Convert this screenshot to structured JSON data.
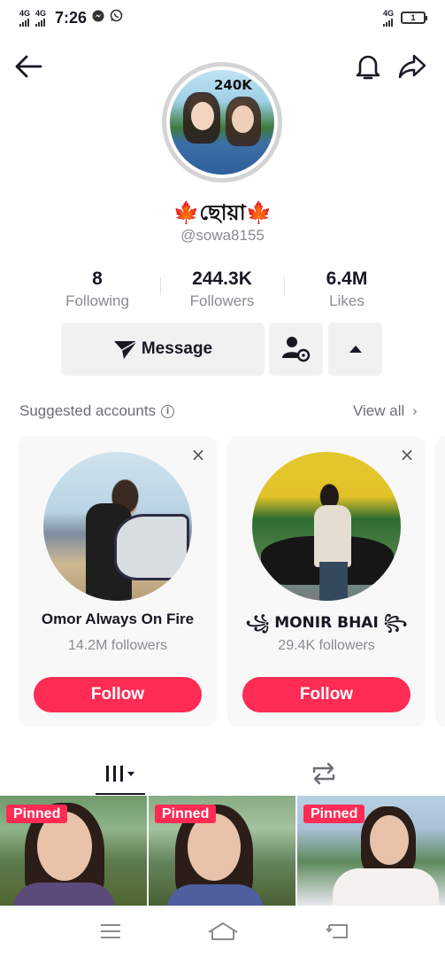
{
  "status_bar": {
    "network_1": "4G",
    "network_2": "4G",
    "time": "7:26",
    "right_network": "4G",
    "battery": "1"
  },
  "profile": {
    "avatar_badge": "240K",
    "display_name": "🍁ছোয়া🍁",
    "username": "@sowa8155",
    "stats": {
      "following_count": "8",
      "following_label": "Following",
      "followers_count": "244.3K",
      "followers_label": "Followers",
      "likes_count": "6.4M",
      "likes_label": "Likes"
    },
    "message_label": "Message"
  },
  "suggested": {
    "title": "Suggested accounts",
    "view_all": "View all",
    "accounts": [
      {
        "name": "Omor Always On Fire",
        "followers": "14.2M followers",
        "follow_label": "Follow"
      },
      {
        "name": "꧁ MONIR BHAI ꧂",
        "followers": "29.4K followers",
        "follow_label": "Follow"
      }
    ]
  },
  "videos": [
    {
      "badge": "Pinned"
    },
    {
      "badge": "Pinned"
    },
    {
      "badge": "Pinned"
    }
  ],
  "colors": {
    "accent": "#fe2c55",
    "text_primary": "#161823",
    "text_secondary": "#8a8b91",
    "button_bg": "#f1f1f2"
  },
  "icons": [
    "back-arrow-icon",
    "bell-icon",
    "share-icon",
    "paper-plane-icon",
    "add-friend-icon",
    "caret-up-icon",
    "info-icon",
    "close-icon",
    "grid-icon",
    "repost-icon",
    "menu-icon",
    "home-icon",
    "back-icon"
  ]
}
